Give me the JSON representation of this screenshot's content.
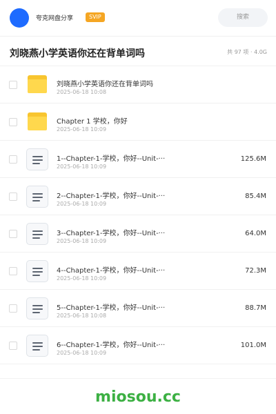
{
  "header": {
    "share_name": "夸克网盘分享",
    "vip_badge": "SVIP",
    "search_label": "搜索"
  },
  "title_bar": {
    "title": "刘晓燕小学英语你还在背单词吗",
    "summary": "共 97 项 · 4.0G"
  },
  "files": [
    {
      "type": "folder",
      "name": "刘晓燕小学英语你还在背单词吗",
      "date": "2025-06-18 10:08",
      "size": ""
    },
    {
      "type": "folder",
      "name": "Chapter 1 学校，你好",
      "date": "2025-06-18 10:09",
      "size": ""
    },
    {
      "type": "file",
      "name": "1--Chapter-1-学校，你好--Unit-···",
      "date": "2025-06-18 10:09",
      "size": "125.6M"
    },
    {
      "type": "file",
      "name": "2--Chapter-1-学校，你好--Unit-···",
      "date": "2025-06-18 10:09",
      "size": "85.4M"
    },
    {
      "type": "file",
      "name": "3--Chapter-1-学校，你好--Unit-···",
      "date": "2025-06-18 10:09",
      "size": "64.0M"
    },
    {
      "type": "file",
      "name": "4--Chapter-1-学校，你好--Unit-···",
      "date": "2025-06-18 10:09",
      "size": "72.3M"
    },
    {
      "type": "file",
      "name": "5--Chapter-1-学校，你好--Unit-···",
      "date": "2025-06-18 10:08",
      "size": "88.7M"
    },
    {
      "type": "file",
      "name": "6--Chapter-1-学校，你好--Unit-···",
      "date": "2025-06-18 10:09",
      "size": "101.0M"
    }
  ],
  "footer": {
    "brand": "miosou.cc"
  },
  "colors": {
    "avatar": "#1e6bff",
    "vip": "#f5a623",
    "folder": "#ffd84d",
    "brand": "#3cb043"
  }
}
